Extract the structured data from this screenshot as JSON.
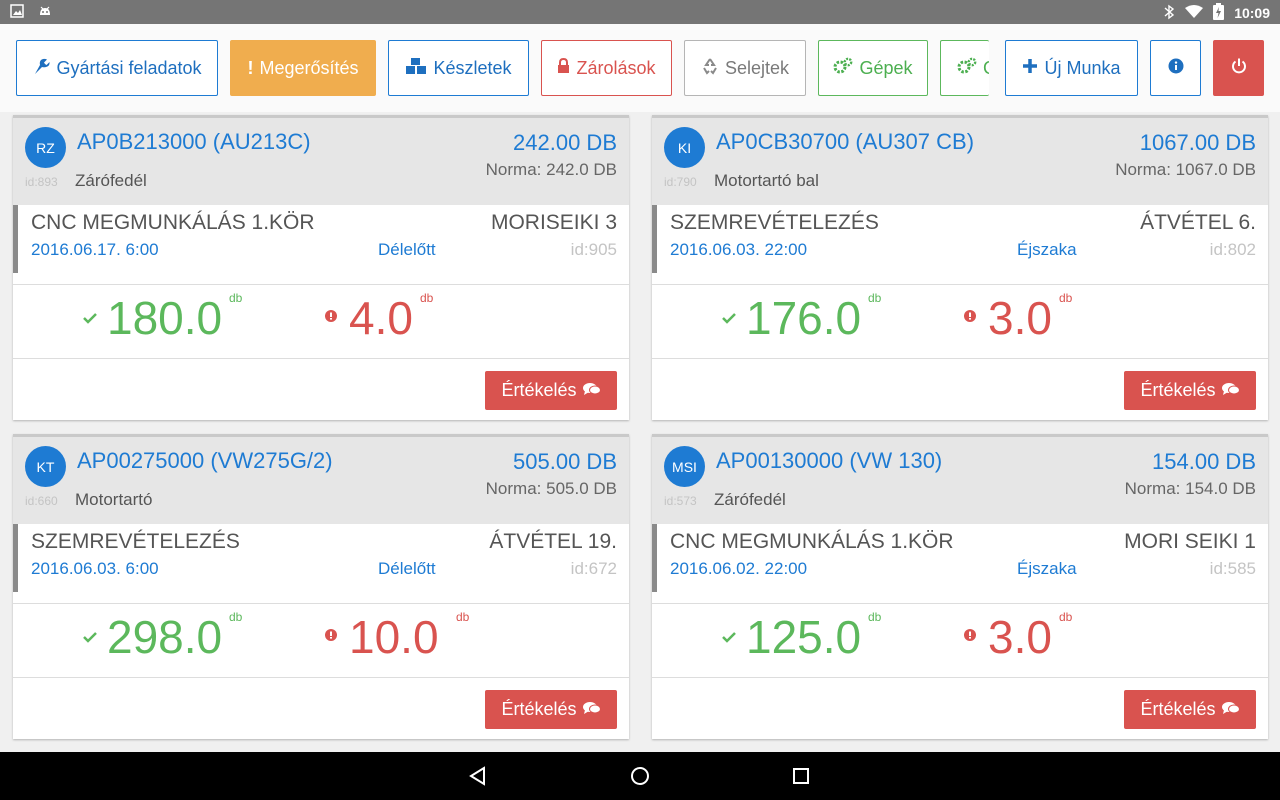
{
  "status_bar": {
    "time": "10:09"
  },
  "toolbar": {
    "tasks_label": "Gyártási feladatok",
    "confirm_label": "Megerősítés",
    "stock_label": "Készletek",
    "locks_label": "Zárolások",
    "scrap_label": "Selejtek",
    "machines_label": "Gépek",
    "truncated_label": "G",
    "new_job_label": "Új Munka"
  },
  "cards": [
    {
      "avatar": "RZ",
      "title": "AP0B213000 (AU213C)",
      "name": "Zárófedél",
      "id": "id:893",
      "qty": "242.00 DB",
      "norm": "Norma: 242.0 DB",
      "operation": "CNC MEGMUNKÁLÁS 1.KÖR",
      "date": "2016.06.17. 6:00",
      "shift": "Délelőtt",
      "machine": "MORISEIKI 3",
      "op_id": "id:905",
      "good": "180.0",
      "bad": "4.0",
      "unit": "db",
      "button": "Értékelés"
    },
    {
      "avatar": "KI",
      "title": "AP0CB30700 (AU307 CB)",
      "name": "Motortartó bal",
      "id": "id:790",
      "qty": "1067.00 DB",
      "norm": "Norma: 1067.0 DB",
      "operation": "SZEMREVÉTELEZÉS",
      "date": "2016.06.03. 22:00",
      "shift": "Éjszaka",
      "machine": "ÁTVÉTEL 6.",
      "op_id": "id:802",
      "good": "176.0",
      "bad": "3.0",
      "unit": "db",
      "button": "Értékelés"
    },
    {
      "avatar": "KT",
      "title": "AP00275000 (VW275G/2)",
      "name": "Motortartó",
      "id": "id:660",
      "qty": "505.00 DB",
      "norm": "Norma: 505.0 DB",
      "operation": "SZEMREVÉTELEZÉS",
      "date": "2016.06.03. 6:00",
      "shift": "Délelőtt",
      "machine": "ÁTVÉTEL 19.",
      "op_id": "id:672",
      "good": "298.0",
      "bad": "10.0",
      "unit": "db",
      "button": "Értékelés"
    },
    {
      "avatar": "MSI",
      "title": "AP00130000 (VW 130)",
      "name": "Zárófedél",
      "id": "id:573",
      "qty": "154.00 DB",
      "norm": "Norma: 154.0 DB",
      "operation": "CNC MEGMUNKÁLÁS 1.KÖR",
      "date": "2016.06.02. 22:00",
      "shift": "Éjszaka",
      "machine": "MORI SEIKI 1",
      "op_id": "id:585",
      "good": "125.0",
      "bad": "3.0",
      "unit": "db",
      "button": "Értékelés"
    }
  ],
  "colors": {
    "accent": "#1e7bd3",
    "warning": "#f0ad4e",
    "danger": "#d9534f",
    "success": "#5cb85c"
  }
}
